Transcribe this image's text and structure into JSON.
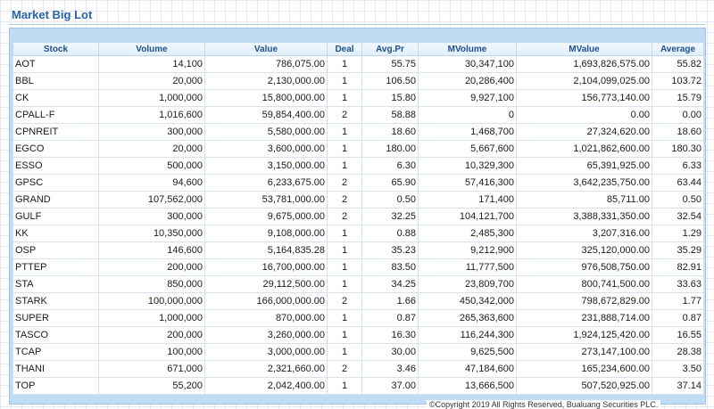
{
  "page": {
    "title": "Market Big Lot",
    "footer": "©Copyright 2019 All Rights Reserved, Bualuang Securities PLC."
  },
  "table": {
    "columns": [
      "Stock",
      "Volume",
      "Value",
      "Deal",
      "Avg.Pr",
      "MVolume",
      "MValue",
      "Average"
    ],
    "rows": [
      [
        "AOT",
        "14,100",
        "786,075.00",
        "1",
        "55.75",
        "30,347,100",
        "1,693,826,575.00",
        "55.82"
      ],
      [
        "BBL",
        "20,000",
        "2,130,000.00",
        "1",
        "106.50",
        "20,286,400",
        "2,104,099,025.00",
        "103.72"
      ],
      [
        "CK",
        "1,000,000",
        "15,800,000.00",
        "1",
        "15.80",
        "9,927,100",
        "156,773,140.00",
        "15.79"
      ],
      [
        "CPALL-F",
        "1,016,600",
        "59,854,400.00",
        "2",
        "58.88",
        "0",
        "0.00",
        "0.00"
      ],
      [
        "CPNREIT",
        "300,000",
        "5,580,000.00",
        "1",
        "18.60",
        "1,468,700",
        "27,324,620.00",
        "18.60"
      ],
      [
        "EGCO",
        "20,000",
        "3,600,000.00",
        "1",
        "180.00",
        "5,667,600",
        "1,021,862,600.00",
        "180.30"
      ],
      [
        "ESSO",
        "500,000",
        "3,150,000.00",
        "1",
        "6.30",
        "10,329,300",
        "65,391,925.00",
        "6.33"
      ],
      [
        "GPSC",
        "94,600",
        "6,233,675.00",
        "2",
        "65.90",
        "57,416,300",
        "3,642,235,750.00",
        "63.44"
      ],
      [
        "GRAND",
        "107,562,000",
        "53,781,000.00",
        "2",
        "0.50",
        "171,400",
        "85,711.00",
        "0.50"
      ],
      [
        "GULF",
        "300,000",
        "9,675,000.00",
        "2",
        "32.25",
        "104,121,700",
        "3,388,331,350.00",
        "32.54"
      ],
      [
        "KK",
        "10,350,000",
        "9,108,000.00",
        "1",
        "0.88",
        "2,485,300",
        "3,207,316.00",
        "1.29"
      ],
      [
        "OSP",
        "146,600",
        "5,164,835.28",
        "1",
        "35.23",
        "9,212,900",
        "325,120,000.00",
        "35.29"
      ],
      [
        "PTTEP",
        "200,000",
        "16,700,000.00",
        "1",
        "83.50",
        "11,777,500",
        "976,508,750.00",
        "82.91"
      ],
      [
        "STA",
        "850,000",
        "29,112,500.00",
        "1",
        "34.25",
        "23,809,700",
        "800,741,500.00",
        "33.63"
      ],
      [
        "STARK",
        "100,000,000",
        "166,000,000.00",
        "2",
        "1.66",
        "450,342,000",
        "798,672,829.00",
        "1.77"
      ],
      [
        "SUPER",
        "1,000,000",
        "870,000.00",
        "1",
        "0.87",
        "265,363,600",
        "231,888,714.00",
        "0.87"
      ],
      [
        "TASCO",
        "200,000",
        "3,260,000.00",
        "1",
        "16.30",
        "116,244,300",
        "1,924,125,420.00",
        "16.55"
      ],
      [
        "TCAP",
        "100,000",
        "3,000,000.00",
        "1",
        "30.00",
        "9,625,500",
        "273,147,100.00",
        "28.38"
      ],
      [
        "THANI",
        "671,000",
        "2,321,660.00",
        "2",
        "3.46",
        "47,184,600",
        "165,234,600.00",
        "3.50"
      ],
      [
        "TOP",
        "55,200",
        "2,042,400.00",
        "1",
        "37.00",
        "13,666,500",
        "507,520,925.00",
        "37.14"
      ]
    ]
  }
}
